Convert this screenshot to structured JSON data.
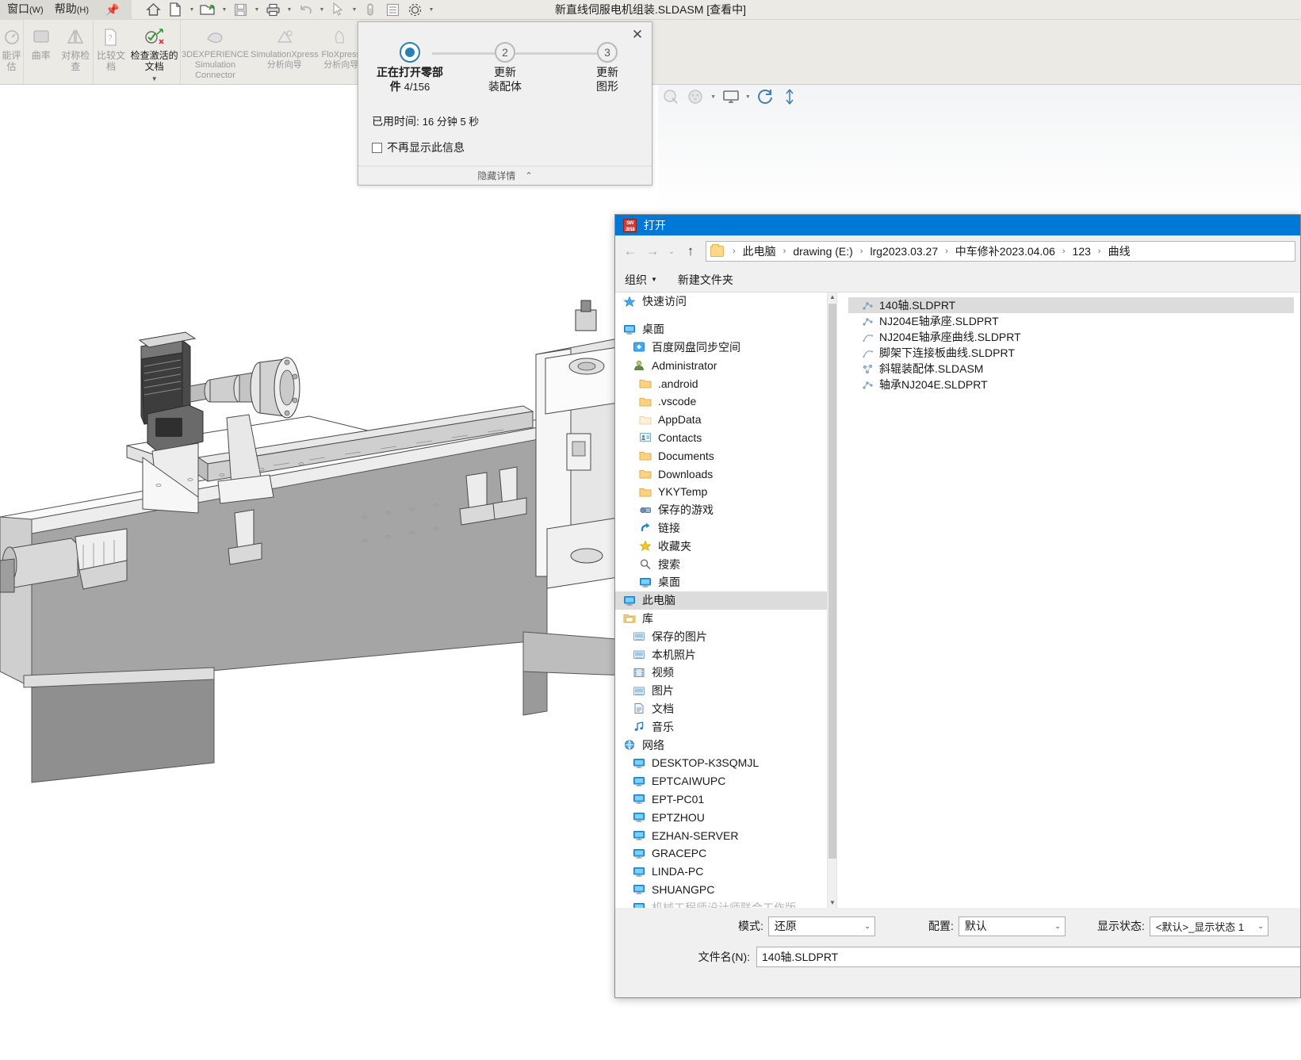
{
  "app": {
    "title": "新直线伺服电机组装.SLDASM [查看中]",
    "menus": [
      {
        "label": "窗口",
        "mnemonic": "(W)"
      },
      {
        "label": "帮助",
        "mnemonic": "(H)"
      }
    ],
    "quick_access": [
      {
        "name": "home-icon",
        "caret": false
      },
      {
        "name": "new-document-icon",
        "caret": true
      },
      {
        "name": "open-folder-icon",
        "caret": true
      },
      {
        "name": "save-icon",
        "caret": true
      },
      {
        "name": "print-icon",
        "caret": true
      },
      {
        "name": "undo-icon",
        "caret": true
      },
      {
        "name": "select-cursor-icon",
        "caret": true
      },
      {
        "name": "measure-icon",
        "caret": false
      },
      {
        "name": "properties-list-icon",
        "caret": false
      },
      {
        "name": "options-gear-icon",
        "caret": true
      }
    ]
  },
  "ribbon": {
    "groups": [
      {
        "buttons": [
          {
            "label": "能评估",
            "icon": "performance-evaluation-icon",
            "enabled": false,
            "caret": false
          }
        ]
      },
      {
        "buttons": [
          {
            "label": "曲率",
            "icon": "curvature-icon",
            "enabled": false,
            "caret": false
          },
          {
            "label": "对称检查",
            "icon": "symmetry-check-icon",
            "enabled": false,
            "caret": false
          }
        ]
      },
      {
        "buttons": [
          {
            "label": "比较文档",
            "icon": "compare-documents-icon",
            "enabled": false,
            "caret": false
          },
          {
            "label": "检查激活的文档",
            "icon": "check-active-document-icon",
            "enabled": true,
            "caret": true
          }
        ]
      },
      {
        "buttons": [
          {
            "label": "3DEXPERIENCE Simulation Connector",
            "icon": "3dexperience-simulation-connector-icon",
            "enabled": false,
            "caret": false
          },
          {
            "label": "SimulationXpress 分析向导",
            "icon": "simulationxpress-icon",
            "enabled": false,
            "caret": false
          },
          {
            "label": "FloXpress 分析向导",
            "icon": "floxpress-icon",
            "enabled": false,
            "caret": false
          }
        ]
      }
    ],
    "right_tools": [
      {
        "name": "appearance-icon",
        "state": "off",
        "caret": false
      },
      {
        "name": "scene-icon",
        "state": "off",
        "caret": true
      },
      {
        "name": "display-screen-icon",
        "state": "off",
        "caret": true
      },
      {
        "name": "rebuild-refresh-icon",
        "state": "on",
        "caret": false
      },
      {
        "name": "reference-geometry-icon",
        "state": "off",
        "caret": false
      }
    ]
  },
  "progress_dialog": {
    "close_label": "✕",
    "steps": [
      {
        "number": "",
        "marker": "dot",
        "line1": "正在打开零部",
        "line2": "件",
        "count": "4/156",
        "active": true
      },
      {
        "number": "2",
        "marker": "number",
        "line1": "更新",
        "line2": "装配体",
        "count": "",
        "active": false
      },
      {
        "number": "3",
        "marker": "number",
        "line1": "更新",
        "line2": "图形",
        "count": "",
        "active": false
      }
    ],
    "elapsed_label": "已用时间:",
    "elapsed_value": "16 分钟 5 秒",
    "dont_show_label": "不再显示此信息",
    "dont_show_checked": false,
    "footer_label": "隐藏详情",
    "footer_chevron": "⌃"
  },
  "open_dialog": {
    "title": "打开",
    "logo_top": "SW",
    "logo_bottom": "2018",
    "nav": {
      "back": "←",
      "forward": "→",
      "recent": "⌄",
      "up": "↑"
    },
    "breadcrumb": [
      "此电脑",
      "drawing (E:)",
      "lrg2023.03.27",
      "中车修补2023.04.06",
      "123",
      "曲线"
    ],
    "commands": [
      {
        "label": "组织",
        "has_caret": true
      },
      {
        "label": "新建文件夹",
        "has_caret": false
      }
    ],
    "tree": [
      {
        "label": "快速访问",
        "icon": "quick-access-star-icon",
        "indent": 1,
        "selected": false
      },
      {
        "label": "",
        "icon": "spacer",
        "indent": 1,
        "selected": false,
        "spacer": true
      },
      {
        "label": "桌面",
        "icon": "desktop-icon",
        "indent": 1,
        "selected": false
      },
      {
        "label": "百度网盘同步空间",
        "icon": "baidu-netdisk-icon",
        "indent": 2,
        "selected": false
      },
      {
        "label": "Administrator",
        "icon": "user-icon",
        "indent": 2,
        "selected": false
      },
      {
        "label": ".android",
        "icon": "folder-icon",
        "indent": 3,
        "selected": false
      },
      {
        "label": ".vscode",
        "icon": "folder-icon",
        "indent": 3,
        "selected": false
      },
      {
        "label": "AppData",
        "icon": "folder-dim-icon",
        "indent": 3,
        "selected": false
      },
      {
        "label": "Contacts",
        "icon": "contacts-icon",
        "indent": 3,
        "selected": false
      },
      {
        "label": "Documents",
        "icon": "folder-icon",
        "indent": 3,
        "selected": false
      },
      {
        "label": "Downloads",
        "icon": "folder-icon",
        "indent": 3,
        "selected": false
      },
      {
        "label": "YKYTemp",
        "icon": "folder-icon",
        "indent": 3,
        "selected": false
      },
      {
        "label": "保存的游戏",
        "icon": "saved-games-icon",
        "indent": 3,
        "selected": false
      },
      {
        "label": "链接",
        "icon": "links-icon",
        "indent": 3,
        "selected": false
      },
      {
        "label": "收藏夹",
        "icon": "favorites-star-icon",
        "indent": 3,
        "selected": false
      },
      {
        "label": "搜索",
        "icon": "search-icon",
        "indent": 3,
        "selected": false
      },
      {
        "label": "桌面",
        "icon": "desktop-icon",
        "indent": 3,
        "selected": false
      },
      {
        "label": "此电脑",
        "icon": "this-pc-icon",
        "indent": 1,
        "selected": true
      },
      {
        "label": "库",
        "icon": "library-icon",
        "indent": 1,
        "selected": false
      },
      {
        "label": "保存的图片",
        "icon": "saved-pictures-icon",
        "indent": 2,
        "selected": false
      },
      {
        "label": "本机照片",
        "icon": "local-photos-icon",
        "indent": 2,
        "selected": false
      },
      {
        "label": "视频",
        "icon": "videos-icon",
        "indent": 2,
        "selected": false
      },
      {
        "label": "图片",
        "icon": "pictures-icon",
        "indent": 2,
        "selected": false
      },
      {
        "label": "文档",
        "icon": "documents-icon",
        "indent": 2,
        "selected": false
      },
      {
        "label": "音乐",
        "icon": "music-icon",
        "indent": 2,
        "selected": false
      },
      {
        "label": "网络",
        "icon": "network-icon",
        "indent": 1,
        "selected": false
      },
      {
        "label": "DESKTOP-K3SQMJL",
        "icon": "computer-icon",
        "indent": 2,
        "selected": false
      },
      {
        "label": "EPTCAIWUPC",
        "icon": "computer-icon",
        "indent": 2,
        "selected": false
      },
      {
        "label": "EPT-PC01",
        "icon": "computer-icon",
        "indent": 2,
        "selected": false
      },
      {
        "label": "EPTZHOU",
        "icon": "computer-icon",
        "indent": 2,
        "selected": false
      },
      {
        "label": "EZHAN-SERVER",
        "icon": "computer-icon",
        "indent": 2,
        "selected": false
      },
      {
        "label": "GRACEPC",
        "icon": "computer-icon",
        "indent": 2,
        "selected": false
      },
      {
        "label": "LINDA-PC",
        "icon": "computer-icon",
        "indent": 2,
        "selected": false
      },
      {
        "label": "SHUANGPC",
        "icon": "computer-icon",
        "indent": 2,
        "selected": false
      },
      {
        "label": "机械工程师设计师联合工作版",
        "icon": "computer-icon",
        "indent": 2,
        "selected": false,
        "clipped": true
      }
    ],
    "files": [
      {
        "name": "140轴.SLDPRT",
        "icon": "sldprt-icon",
        "selected": true
      },
      {
        "name": "NJ204E轴承座.SLDPRT",
        "icon": "sldprt-icon",
        "selected": false
      },
      {
        "name": "NJ204E轴承座曲线.SLDPRT",
        "icon": "sldprt-curve-icon",
        "selected": false
      },
      {
        "name": "脚架下连接板曲线.SLDPRT",
        "icon": "sldprt-curve-icon",
        "selected": false
      },
      {
        "name": "斜辊装配体.SLDASM",
        "icon": "sldasm-icon",
        "selected": false
      },
      {
        "name": "轴承NJ204E.SLDPRT",
        "icon": "sldprt-icon",
        "selected": false
      }
    ],
    "options": {
      "mode_label": "模式:",
      "mode_value": "还原",
      "config_label": "配置:",
      "config_value": "默认",
      "display_state_label": "显示状态:",
      "display_state_value": "<默认>_显示状态 1"
    },
    "filename_label": "文件名(N):",
    "filename_value": "140轴.SLDPRT"
  },
  "colors": {
    "accent_blue": "#0078d7",
    "progress_active": "#2b7fb8",
    "titlebar": "#0078d7",
    "chrome": "#f0f0f0",
    "ribbon": "#eceae5",
    "selection": "#dcdcdc"
  }
}
